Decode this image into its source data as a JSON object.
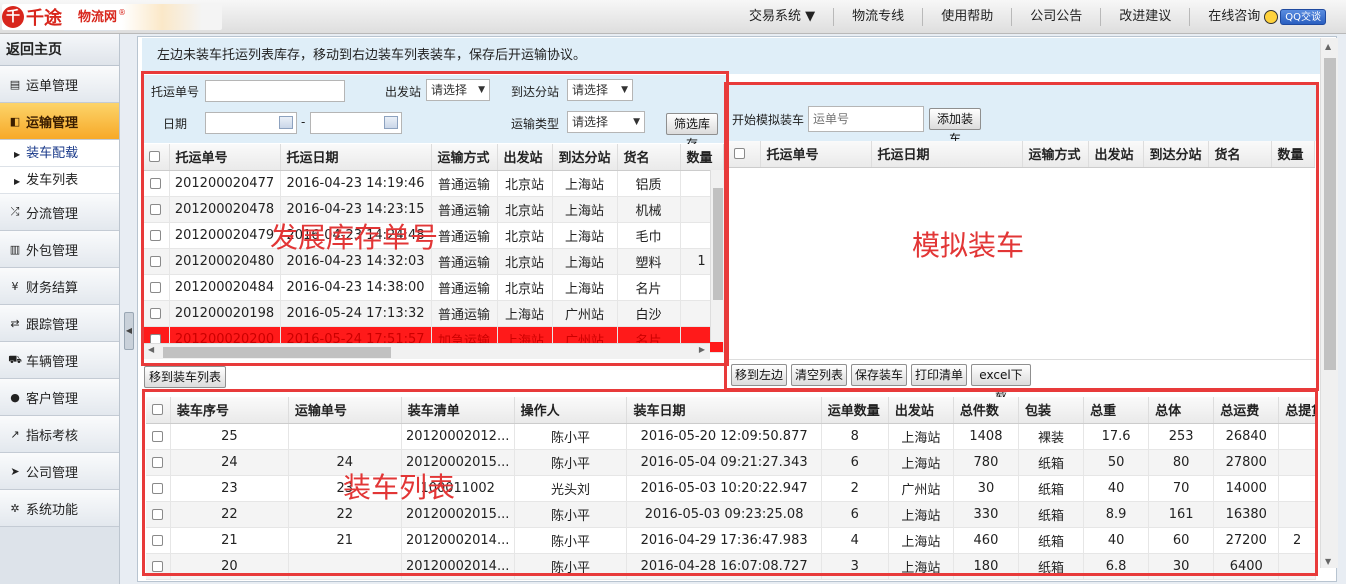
{
  "brand": {
    "logo_mark": "千",
    "name": "千途",
    "suffix": "物流网",
    "reg": "®"
  },
  "topnav": [
    {
      "label": "交易系统 ▼"
    },
    {
      "label": "物流专线"
    },
    {
      "label": "使用帮助"
    },
    {
      "label": "公司公告"
    },
    {
      "label": "改进建议"
    },
    {
      "label": "在线咨询"
    }
  ],
  "qq": {
    "label": "QQ交谈"
  },
  "sidebar": {
    "home": "返回主页",
    "items": [
      {
        "label": "运单管理",
        "icon": "file-icon",
        "glyph": "▤"
      },
      {
        "label": "运输管理",
        "icon": "copy-icon",
        "glyph": "◧",
        "active": true
      },
      {
        "label": "分流管理",
        "icon": "shuffle-icon",
        "glyph": "⤮"
      },
      {
        "label": "外包管理",
        "icon": "briefcase-icon",
        "glyph": "▥"
      },
      {
        "label": "财务结算",
        "icon": "yen-icon",
        "glyph": "¥"
      },
      {
        "label": "跟踪管理",
        "icon": "retweet-icon",
        "glyph": "⇄"
      },
      {
        "label": "车辆管理",
        "icon": "car-icon",
        "glyph": "⛟"
      },
      {
        "label": "客户管理",
        "icon": "user-icon",
        "glyph": "●"
      },
      {
        "label": "指标考核",
        "icon": "chart-icon",
        "glyph": "↗"
      },
      {
        "label": "公司管理",
        "icon": "send-icon",
        "glyph": "➤"
      },
      {
        "label": "系统功能",
        "icon": "gear-icon",
        "glyph": "✲"
      }
    ],
    "subitems": [
      "装车配载",
      "发车列表"
    ]
  },
  "notice": "左边未装车托运列表库存，移动到右边装车列表装车，保存后开运输协议。",
  "filter": {
    "waybill_label": "托运单号",
    "waybill_value": "",
    "from_label": "出发站",
    "from_value": "请选择",
    "to_label": "到达分站",
    "to_value": "请选择",
    "date_label": "日期",
    "date_sep": "-",
    "type_label": "运输类型",
    "type_value": "请选择",
    "filter_btn": "筛选库存"
  },
  "left_table": {
    "columns": [
      "托运单号",
      "托运日期",
      "运输方式",
      "出发站",
      "到达分站",
      "货名",
      "数量"
    ],
    "rows": [
      [
        "201200020477",
        "2016-04-23 14:19:46",
        "普通运输",
        "北京站",
        "上海站",
        "铝质",
        ""
      ],
      [
        "201200020478",
        "2016-04-23 14:23:15",
        "普通运输",
        "北京站",
        "上海站",
        "机械",
        ""
      ],
      [
        "201200020479",
        "2016-04-23 14:24:48",
        "普通运输",
        "北京站",
        "上海站",
        "毛巾",
        ""
      ],
      [
        "201200020480",
        "2016-04-23 14:32:03",
        "普通运输",
        "北京站",
        "上海站",
        "塑料",
        "1"
      ],
      [
        "201200020484",
        "2016-04-23 14:38:00",
        "普通运输",
        "北京站",
        "上海站",
        "名片",
        ""
      ],
      [
        "201200020198",
        "2016-05-24 17:13:32",
        "普通运输",
        "上海站",
        "广州站",
        "白沙",
        ""
      ],
      [
        "201200020200",
        "2016-05-24 17:51:57",
        "加急运输",
        "上海站",
        "广州站",
        "名片",
        ""
      ]
    ]
  },
  "move_right_btn": "移到装车列表",
  "sim": {
    "label": "开始模拟装车",
    "placeholder": "运单号",
    "add_btn": "添加装车"
  },
  "right_table": {
    "columns": [
      "托运单号",
      "托运日期",
      "运输方式",
      "出发站",
      "到达分站",
      "货名",
      "数量"
    ]
  },
  "right_buttons": [
    "移到左边",
    "清空列表",
    "保存装车",
    "打印清单",
    "excel下载"
  ],
  "load_table": {
    "columns": [
      "装车序号",
      "运输单号",
      "装车清单",
      "操作人",
      "装车日期",
      "运单数量",
      "出发站",
      "总件数",
      "包装",
      "总重",
      "总体",
      "总运费",
      "总提货"
    ],
    "rows": [
      [
        "25",
        "",
        "20120002012...",
        "陈小平",
        "2016-05-20 12:09:50.877",
        "8",
        "上海站",
        "1408",
        "裸装",
        "17.6",
        "253",
        "26840",
        ""
      ],
      [
        "24",
        "24",
        "20120002015...",
        "陈小平",
        "2016-05-04 09:21:27.343",
        "6",
        "上海站",
        "780",
        "纸箱",
        "50",
        "80",
        "27800",
        ""
      ],
      [
        "23",
        "23",
        "100011002",
        "光头刘",
        "2016-05-03 10:20:22.947",
        "2",
        "广州站",
        "30",
        "纸箱",
        "40",
        "70",
        "14000",
        ""
      ],
      [
        "22",
        "22",
        "20120002015...",
        "陈小平",
        "2016-05-03 09:23:25.08",
        "6",
        "上海站",
        "330",
        "纸箱",
        "8.9",
        "161",
        "16380",
        ""
      ],
      [
        "21",
        "21",
        "20120002014...",
        "陈小平",
        "2016-04-29 17:36:47.983",
        "4",
        "上海站",
        "460",
        "纸箱",
        "40",
        "60",
        "27200",
        "2"
      ],
      [
        "20",
        "",
        "20120002014...",
        "陈小平",
        "2016-04-28 16:07:08.727",
        "3",
        "上海站",
        "180",
        "纸箱",
        "6.8",
        "30",
        "6400",
        ""
      ]
    ]
  },
  "annotations": {
    "left": "发展库存单号",
    "right": "模拟装车",
    "bottom": "装车列表"
  },
  "colors": {
    "annotation": "#e23636",
    "active_menu": "#f7a928",
    "highlight_row": "#ff1a1a",
    "panel_bg": "#dfeef8"
  }
}
